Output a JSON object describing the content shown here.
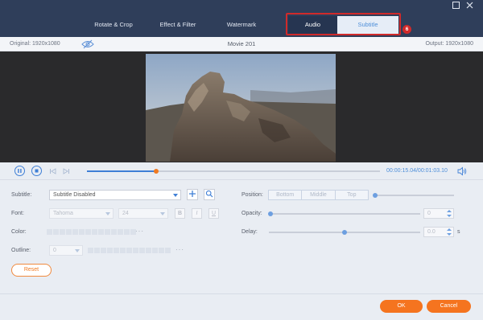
{
  "tabs": {
    "rotate_crop": "Rotate & Crop",
    "effect_filter": "Effect & Filter",
    "watermark": "Watermark",
    "audio": "Audio",
    "subtitle": "Subtitle"
  },
  "annotation": {
    "step": "6",
    "color": "#d12a2a"
  },
  "info": {
    "original": "Original: 1920x1080",
    "title": "Movie 201",
    "output": "Output: 1920x1080"
  },
  "playback": {
    "progress_fraction": 0.236,
    "time": "00:00:15.04/00:01:03.10"
  },
  "subtitle_panel": {
    "subtitle_label": "Subtitle:",
    "subtitle_value": "Subtitle Disabled",
    "font_label": "Font:",
    "font_value": "Tahoma",
    "font_size": "24",
    "bold": "B",
    "italic": "I",
    "underline": "U",
    "color_label": "Color:",
    "outline_label": "Outline:",
    "outline_value": "0",
    "more": "···",
    "position_label": "Position:",
    "position_options": [
      "Bottom",
      "Middle",
      "Top"
    ],
    "opacity_label": "Opacity:",
    "opacity_value": "0",
    "delay_label": "Delay:",
    "delay_value": "0.0",
    "delay_unit": "s",
    "reset": "Reset"
  },
  "actions": {
    "ok": "OK",
    "cancel": "Cancel"
  },
  "colors": {
    "accent": "#3f7fd6",
    "orange": "#f5741f",
    "topbar": "#2f3e5a"
  }
}
